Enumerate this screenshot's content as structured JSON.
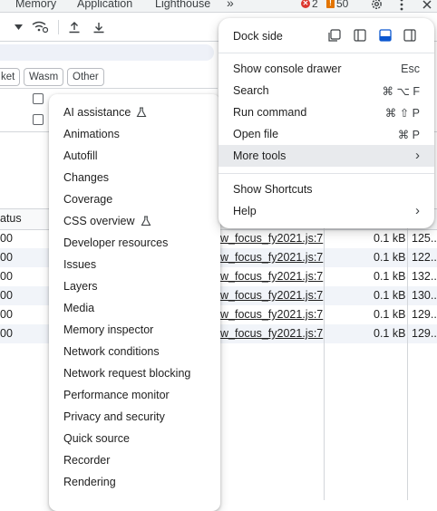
{
  "tabs": [
    "Memory",
    "Application",
    "Lighthouse"
  ],
  "tab_overflow": "»",
  "error_count": "2",
  "warning_count": "50",
  "filter_chips": [
    "ket",
    "Wasm",
    "Other"
  ],
  "grid": {
    "status_header": "atus",
    "rows": [
      {
        "status": "00",
        "initiator": "w_focus_fy2021.js:7",
        "size": "0.1 kB",
        "time": "125..."
      },
      {
        "status": "00",
        "initiator": "w_focus_fy2021.js:7",
        "size": "0.1 kB",
        "time": "122..."
      },
      {
        "status": "00",
        "initiator": "w_focus_fy2021.js:7",
        "size": "0.1 kB",
        "time": "132..."
      },
      {
        "status": "00",
        "initiator": "w_focus_fy2021.js:7",
        "size": "0.1 kB",
        "time": "130..."
      },
      {
        "status": "00",
        "initiator": "w_focus_fy2021.js:7",
        "size": "0.1 kB",
        "time": "129..."
      },
      {
        "status": "00",
        "initiator": "w_focus_fy2021.js:7",
        "size": "0.1 kB",
        "time": "129..."
      }
    ]
  },
  "main_menu": {
    "dock_side_label": "Dock side",
    "items": [
      {
        "label": "Show console drawer",
        "shortcut": "Esc"
      },
      {
        "label": "Search",
        "shortcut": "⌘ ⌥ F"
      },
      {
        "label": "Run command",
        "shortcut": "⌘ ⇧ P"
      },
      {
        "label": "Open file",
        "shortcut": "⌘ P"
      },
      {
        "label": "More tools",
        "shortcut": "›"
      }
    ],
    "items2": [
      {
        "label": "Show Shortcuts",
        "shortcut": ""
      },
      {
        "label": "Help",
        "shortcut": "›"
      }
    ]
  },
  "more_tools": [
    "AI assistance",
    "Animations",
    "Autofill",
    "Changes",
    "Coverage",
    "CSS overview",
    "Developer resources",
    "Issues",
    "Layers",
    "Media",
    "Memory inspector",
    "Network conditions",
    "Network request blocking",
    "Performance monitor",
    "Privacy and security",
    "Quick source",
    "Recorder",
    "Rendering"
  ],
  "colors": {
    "accent": "#0b57d0",
    "error": "#dc362e",
    "warning": "#e37400"
  }
}
